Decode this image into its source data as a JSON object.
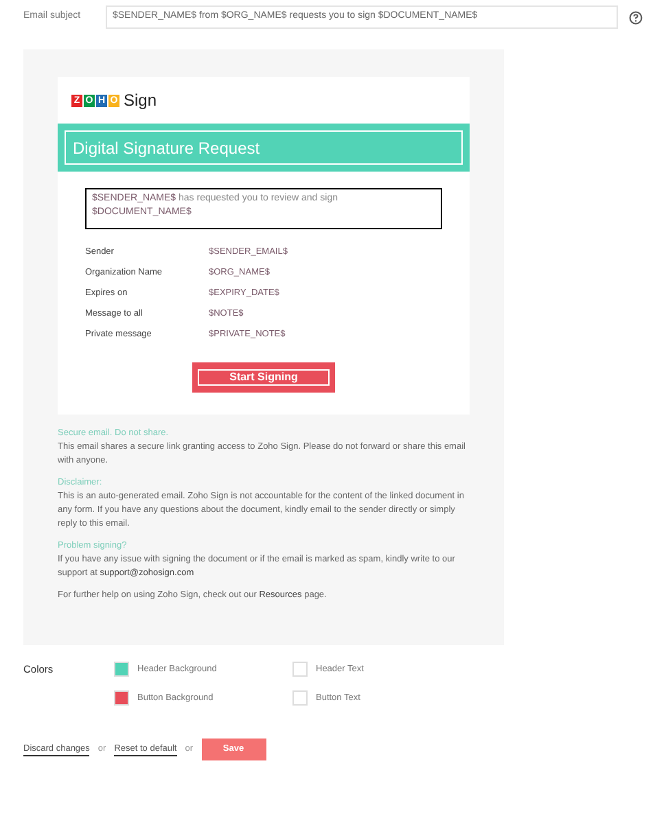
{
  "subject": {
    "label": "Email subject",
    "value": "$SENDER_NAME$ from $ORG_NAME$ requests you to sign $DOCUMENT_NAME$"
  },
  "preview": {
    "logo": {
      "tiles": [
        {
          "letter": "Z",
          "color": "#e42527"
        },
        {
          "letter": "O",
          "color": "#089949"
        },
        {
          "letter": "H",
          "color": "#226db4"
        },
        {
          "letter": "O",
          "color": "#f9b21d"
        }
      ],
      "text": "Sign"
    },
    "header": {
      "title": "Digital Signature Request",
      "color": "#52d3b6"
    },
    "message": "**$SENDER_NAME$** has requested you to review and sign **$DOCUMENT_NAME$**",
    "details": [
      {
        "label": "Sender",
        "value": "$SENDER_EMAIL$"
      },
      {
        "label": "Organization Name",
        "value": "$ORG_NAME$"
      },
      {
        "label": "Expires on",
        "value": "$EXPIRY_DATE$"
      },
      {
        "label": "Message to all",
        "value": "$NOTE$"
      },
      {
        "label": "Private message",
        "value": "$PRIVATE_NOTE$"
      }
    ],
    "button": {
      "label": "Start Signing",
      "color": "#e84e5a"
    },
    "footer": [
      {
        "heading": "Secure email. Do not share.",
        "text": "This email shares a secure link granting access to Zoho Sign. Please do not forward or share this email with anyone."
      },
      {
        "heading": "Disclaimer:",
        "text": "This is an auto-generated email. Zoho Sign is not accountable for the content of the linked document in any form. If you have any questions about the document, kindly email to the sender directly or simply reply to this email."
      },
      {
        "heading": "Problem signing?",
        "text": "If you have any issue with signing the document or if the email is marked as spam, kindly write to our support at ",
        "link": "support@zohosign.com"
      },
      {
        "text": "For further help on using Zoho Sign, check out our ",
        "link": "Resources",
        "after": " page."
      }
    ]
  },
  "colors": {
    "label": "Colors",
    "items": [
      {
        "label": "Header Background",
        "color": "#52d3b6"
      },
      {
        "label": "Header Text",
        "color": "#ffffff"
      },
      {
        "label": "Button Background",
        "color": "#e84e5a"
      },
      {
        "label": "Button Text",
        "color": "#ffffff"
      }
    ]
  },
  "actions": {
    "discard": "Discard changes",
    "or1": "or",
    "reset": "Reset to default",
    "or2": "or",
    "save": "Save"
  }
}
